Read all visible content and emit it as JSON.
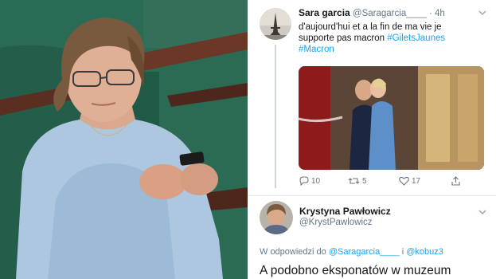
{
  "tweet1": {
    "name": "Sara garcia",
    "handle": "@Saragarcia____",
    "time": "· 4h",
    "text_line1": "d'aujourd'hui et a la fin de ma vie je",
    "text_line2_plain": "supporte pas macron ",
    "hashtag1": "#GiletsJaunes",
    "hashtag2": "#Macron",
    "reply_count": "10",
    "retweet_count": "5",
    "like_count": "17"
  },
  "tweet2": {
    "name": "Krystyna Pawłowicz",
    "handle": "@KrystPawlowicz",
    "reply_prefix": "W odpowiedzi do ",
    "reply_user1": "@Saragarcia____",
    "reply_join": " i ",
    "reply_user2": "@kobuz3",
    "text_start": "A podobno eksponatów w muzeum"
  },
  "colors": {
    "link": "#1da1f2",
    "text": "#14171a",
    "muted": "#657786"
  },
  "icons": [
    "reply-icon",
    "retweet-icon",
    "like-icon",
    "share-icon",
    "chevron-down-icon"
  ]
}
